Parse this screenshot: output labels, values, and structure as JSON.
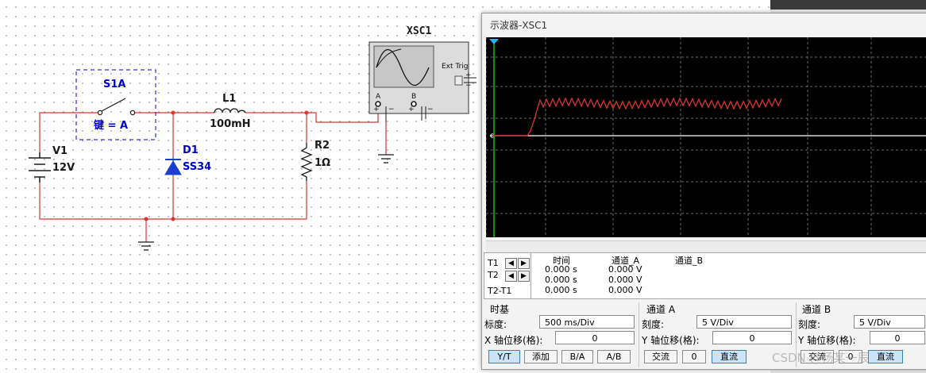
{
  "schematic": {
    "instrument_name": "XSC1",
    "scope_icon": {
      "ext_trig": "Ext Trig",
      "ch_a": "A",
      "ch_b": "B",
      "minus": "−",
      "plus": "+"
    },
    "switch": {
      "name": "S1A",
      "key": "键 = A"
    },
    "battery": {
      "name": "V1",
      "value": "12V"
    },
    "inductor": {
      "name": "L1",
      "value": "100mH"
    },
    "diode": {
      "name": "D1",
      "value": "SS34"
    },
    "resistor": {
      "name": "R2",
      "value": "1Ω"
    },
    "colors": {
      "wire": "#e03131",
      "label_blue": "#0000cc",
      "component": "#1a1a1a"
    }
  },
  "scope_window": {
    "title": "示波器-XSC1",
    "trace_color": "#e03131",
    "baseline_color": "#ffffff",
    "grid_color": "#666666",
    "cursor_color": "#00d000",
    "readout": {
      "rows": [
        "T1",
        "T2",
        "T2-T1"
      ],
      "headers": {
        "time": "时间",
        "ch_a": "通道_A",
        "ch_b": "通道_B"
      },
      "time_values": [
        "0.000 s",
        "0.000 s",
        "0.000 s"
      ],
      "cha_values": [
        "0.000 V",
        "0.000 V",
        "0.000 V"
      ],
      "arrow_left": "◀",
      "arrow_right": "▶"
    },
    "timebase": {
      "title": "时基",
      "scale_label": "标度:",
      "scale_value": "500 ms/Div",
      "offset_label": "X 轴位移(格):",
      "offset_value": "0",
      "buttons": [
        "Y/T",
        "添加",
        "B/A",
        "A/B"
      ],
      "selected": "Y/T"
    },
    "channel_a": {
      "title": "通道 A",
      "scale_label": "刻度:",
      "scale_value": "5  V/Div",
      "offset_label": "Y 轴位移(格):",
      "offset_value": "0",
      "buttons": [
        "交流",
        "0",
        "直流"
      ],
      "selected": "直流"
    },
    "channel_b": {
      "title": "通道 B",
      "scale_label": "刻度:",
      "scale_value": "5  V/Div",
      "offset_label": "Y 轴位移(格):",
      "offset_value": "0",
      "buttons": [
        "交流",
        "0",
        "直流"
      ],
      "selected": "直流"
    }
  },
  "watermark": "CSDN @杨某一辰"
}
